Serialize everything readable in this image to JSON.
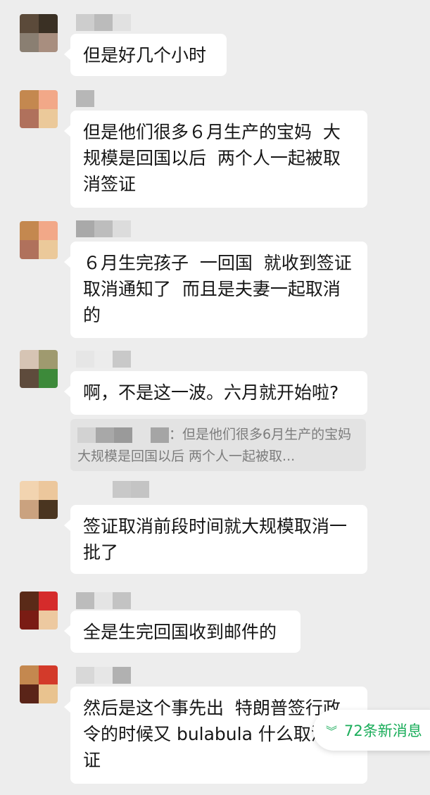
{
  "messages": [
    {
      "text": "但是好几个小时"
    },
    {
      "text": "但是他们很多６月生产的宝妈  大规模是回国以后  两个人一起被取消签证"
    },
    {
      "text": "６月生完孩子  一回国  就收到签证取消通知了  而且是夫妻一起取消的"
    },
    {
      "text": "啊，不是这一波。六月就开始啦?"
    },
    {
      "text": "签证取消前段时间就大规模取消一批了"
    },
    {
      "text": "全是生完回国收到邮件的"
    },
    {
      "text": "然后是这个事先出  特朗普签行政令的时候又 bulabula 什么取消签证"
    }
  ],
  "quote": {
    "text": "：但是他们很多6月生产的宝妈  大规模是回国以后  两个人一起被取..."
  },
  "new_messages": {
    "label": "72条新消息",
    "icon": "double-chevron-down-icon",
    "color": "#1aad5a"
  }
}
